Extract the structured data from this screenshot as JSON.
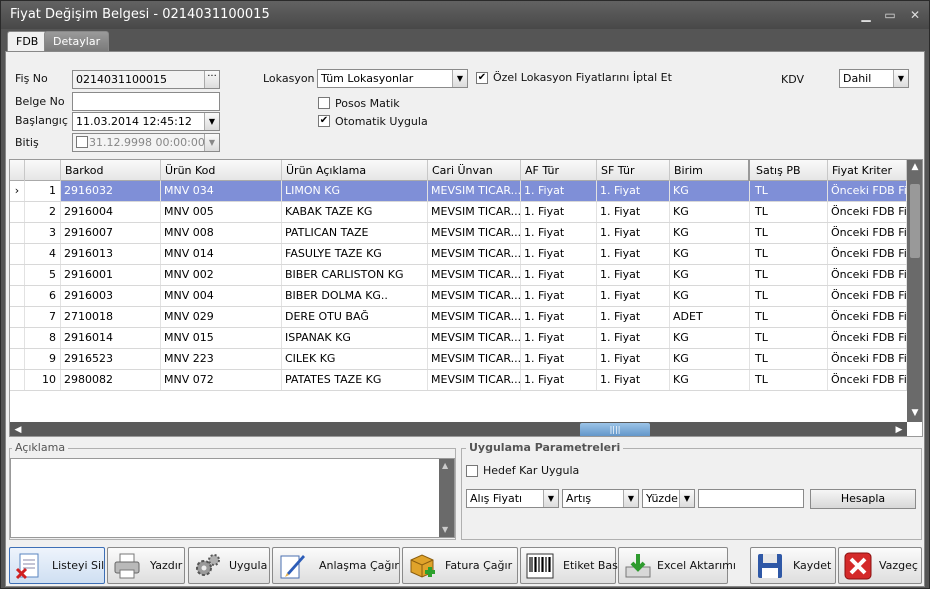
{
  "window": {
    "title": "Fiyat Değişim Belgesi - 0214031100015"
  },
  "tabs": [
    {
      "label": "FDB"
    },
    {
      "label": "Detaylar"
    }
  ],
  "form": {
    "fis_no_label": "Fiş No",
    "fis_no_value": "0214031100015",
    "belge_no_label": "Belge No",
    "belge_no_value": "",
    "baslangic_label": "Başlangıç",
    "baslangic_value": "11.03.2014 12:45:12",
    "bitis_label": "Bitiş",
    "bitis_value": "31.12.9998 00:00:00",
    "lokasyon_label": "Lokasyon",
    "lokasyon_value": "Tüm Lokasyonlar",
    "ozel_lokasyon_label": "Özel Lokasyon Fiyatlarını İptal Et",
    "ozel_lokasyon_checked": true,
    "posos_matik_label": "Posos Matik",
    "posos_matik_checked": false,
    "otomatik_uygula_label": "Otomatik Uygula",
    "otomatik_uygula_checked": true,
    "kdv_label": "KDV",
    "kdv_value": "Dahil"
  },
  "grid": {
    "columns": [
      "Barkod",
      "Ürün Kod",
      "Ürün Açıklama",
      "Cari Ünvan",
      "AF Tür",
      "SF Tür",
      "Birim",
      "Satış PB",
      "Fiyat Kriter"
    ],
    "rows": [
      {
        "no": "1",
        "barkod": "2916032",
        "urun_kod": "MNV 034",
        "aciklama": "LIMON  KG",
        "cari": "MEVSIM TICAR...",
        "af": "1. Fiyat",
        "sf": "1. Fiyat",
        "birim": "KG",
        "pb": "TL",
        "kriter": "Önceki FDB Fi..."
      },
      {
        "no": "2",
        "barkod": "2916004",
        "urun_kod": "MNV 005",
        "aciklama": "KABAK TAZE KG",
        "cari": "MEVSIM TICAR...",
        "af": "1. Fiyat",
        "sf": "1. Fiyat",
        "birim": "KG",
        "pb": "TL",
        "kriter": "Önceki FDB Fi..."
      },
      {
        "no": "3",
        "barkod": "2916007",
        "urun_kod": "MNV 008",
        "aciklama": "PATLICAN TAZE",
        "cari": "MEVSIM TICAR...",
        "af": "1. Fiyat",
        "sf": "1. Fiyat",
        "birim": "KG",
        "pb": "TL",
        "kriter": "Önceki FDB Fi..."
      },
      {
        "no": "4",
        "barkod": "2916013",
        "urun_kod": "MNV 014",
        "aciklama": "FASULYE TAZE KG",
        "cari": "MEVSIM TICAR...",
        "af": "1. Fiyat",
        "sf": "1. Fiyat",
        "birim": "KG",
        "pb": "TL",
        "kriter": "Önceki FDB Fi..."
      },
      {
        "no": "5",
        "barkod": "2916001",
        "urun_kod": "MNV 002",
        "aciklama": "BIBER CARLISTON KG",
        "cari": "MEVSIM TICAR...",
        "af": "1. Fiyat",
        "sf": "1. Fiyat",
        "birim": "KG",
        "pb": "TL",
        "kriter": "Önceki FDB Fi..."
      },
      {
        "no": "6",
        "barkod": "2916003",
        "urun_kod": "MNV 004",
        "aciklama": "BIBER DOLMA KG..",
        "cari": "MEVSIM TICAR...",
        "af": "1. Fiyat",
        "sf": "1. Fiyat",
        "birim": "KG",
        "pb": "TL",
        "kriter": "Önceki FDB Fi..."
      },
      {
        "no": "7",
        "barkod": "2710018",
        "urun_kod": "MNV 029",
        "aciklama": "DERE OTU BAĞ",
        "cari": "MEVSIM TICAR...",
        "af": "1. Fiyat",
        "sf": "1. Fiyat",
        "birim": "ADET",
        "pb": "TL",
        "kriter": "Önceki FDB Fi..."
      },
      {
        "no": "8",
        "barkod": "2916014",
        "urun_kod": "MNV 015",
        "aciklama": "ISPANAK   KG",
        "cari": "MEVSIM TICAR...",
        "af": "1. Fiyat",
        "sf": "1. Fiyat",
        "birim": "KG",
        "pb": "TL",
        "kriter": "Önceki FDB Fi..."
      },
      {
        "no": "9",
        "barkod": "2916523",
        "urun_kod": "MNV 223",
        "aciklama": "CILEK  KG",
        "cari": "MEVSIM TICAR...",
        "af": "1. Fiyat",
        "sf": "1. Fiyat",
        "birim": "KG",
        "pb": "TL",
        "kriter": "Önceki FDB Fi..."
      },
      {
        "no": "10",
        "barkod": "2980082",
        "urun_kod": "MNV 072",
        "aciklama": "PATATES TAZE KG",
        "cari": "MEVSIM TICAR...",
        "af": "1. Fiyat",
        "sf": "1. Fiyat",
        "birim": "KG",
        "pb": "TL",
        "kriter": "Önceki FDB Fi..."
      }
    ]
  },
  "aciklama": {
    "title": "Açıklama",
    "value": ""
  },
  "uygulama": {
    "title": "Uygulama Parametreleri",
    "hedef_kar_label": "Hedef Kar Uygula",
    "hedef_kar_checked": false,
    "fiyat_select": "Alış Fiyatı",
    "yon_select": "Artış",
    "tip_select": "Yüzde",
    "deger_value": "",
    "hesapla_label": "Hesapla"
  },
  "toolbar": {
    "listeyi_sil": "Listeyi Sil",
    "yazdir": "Yazdır",
    "uygula": "Uygula",
    "anlasma_cagir": "Anlaşma Çağır",
    "fatura_cagir": "Fatura Çağır",
    "etiket_bas": "Etiket Bas",
    "excel_aktarimi": "Excel Aktarımı",
    "kaydet": "Kaydet",
    "vazgec": "Vazgeç"
  },
  "colors": {
    "selection": "#7f8fd7",
    "titlebar": "#545454"
  }
}
